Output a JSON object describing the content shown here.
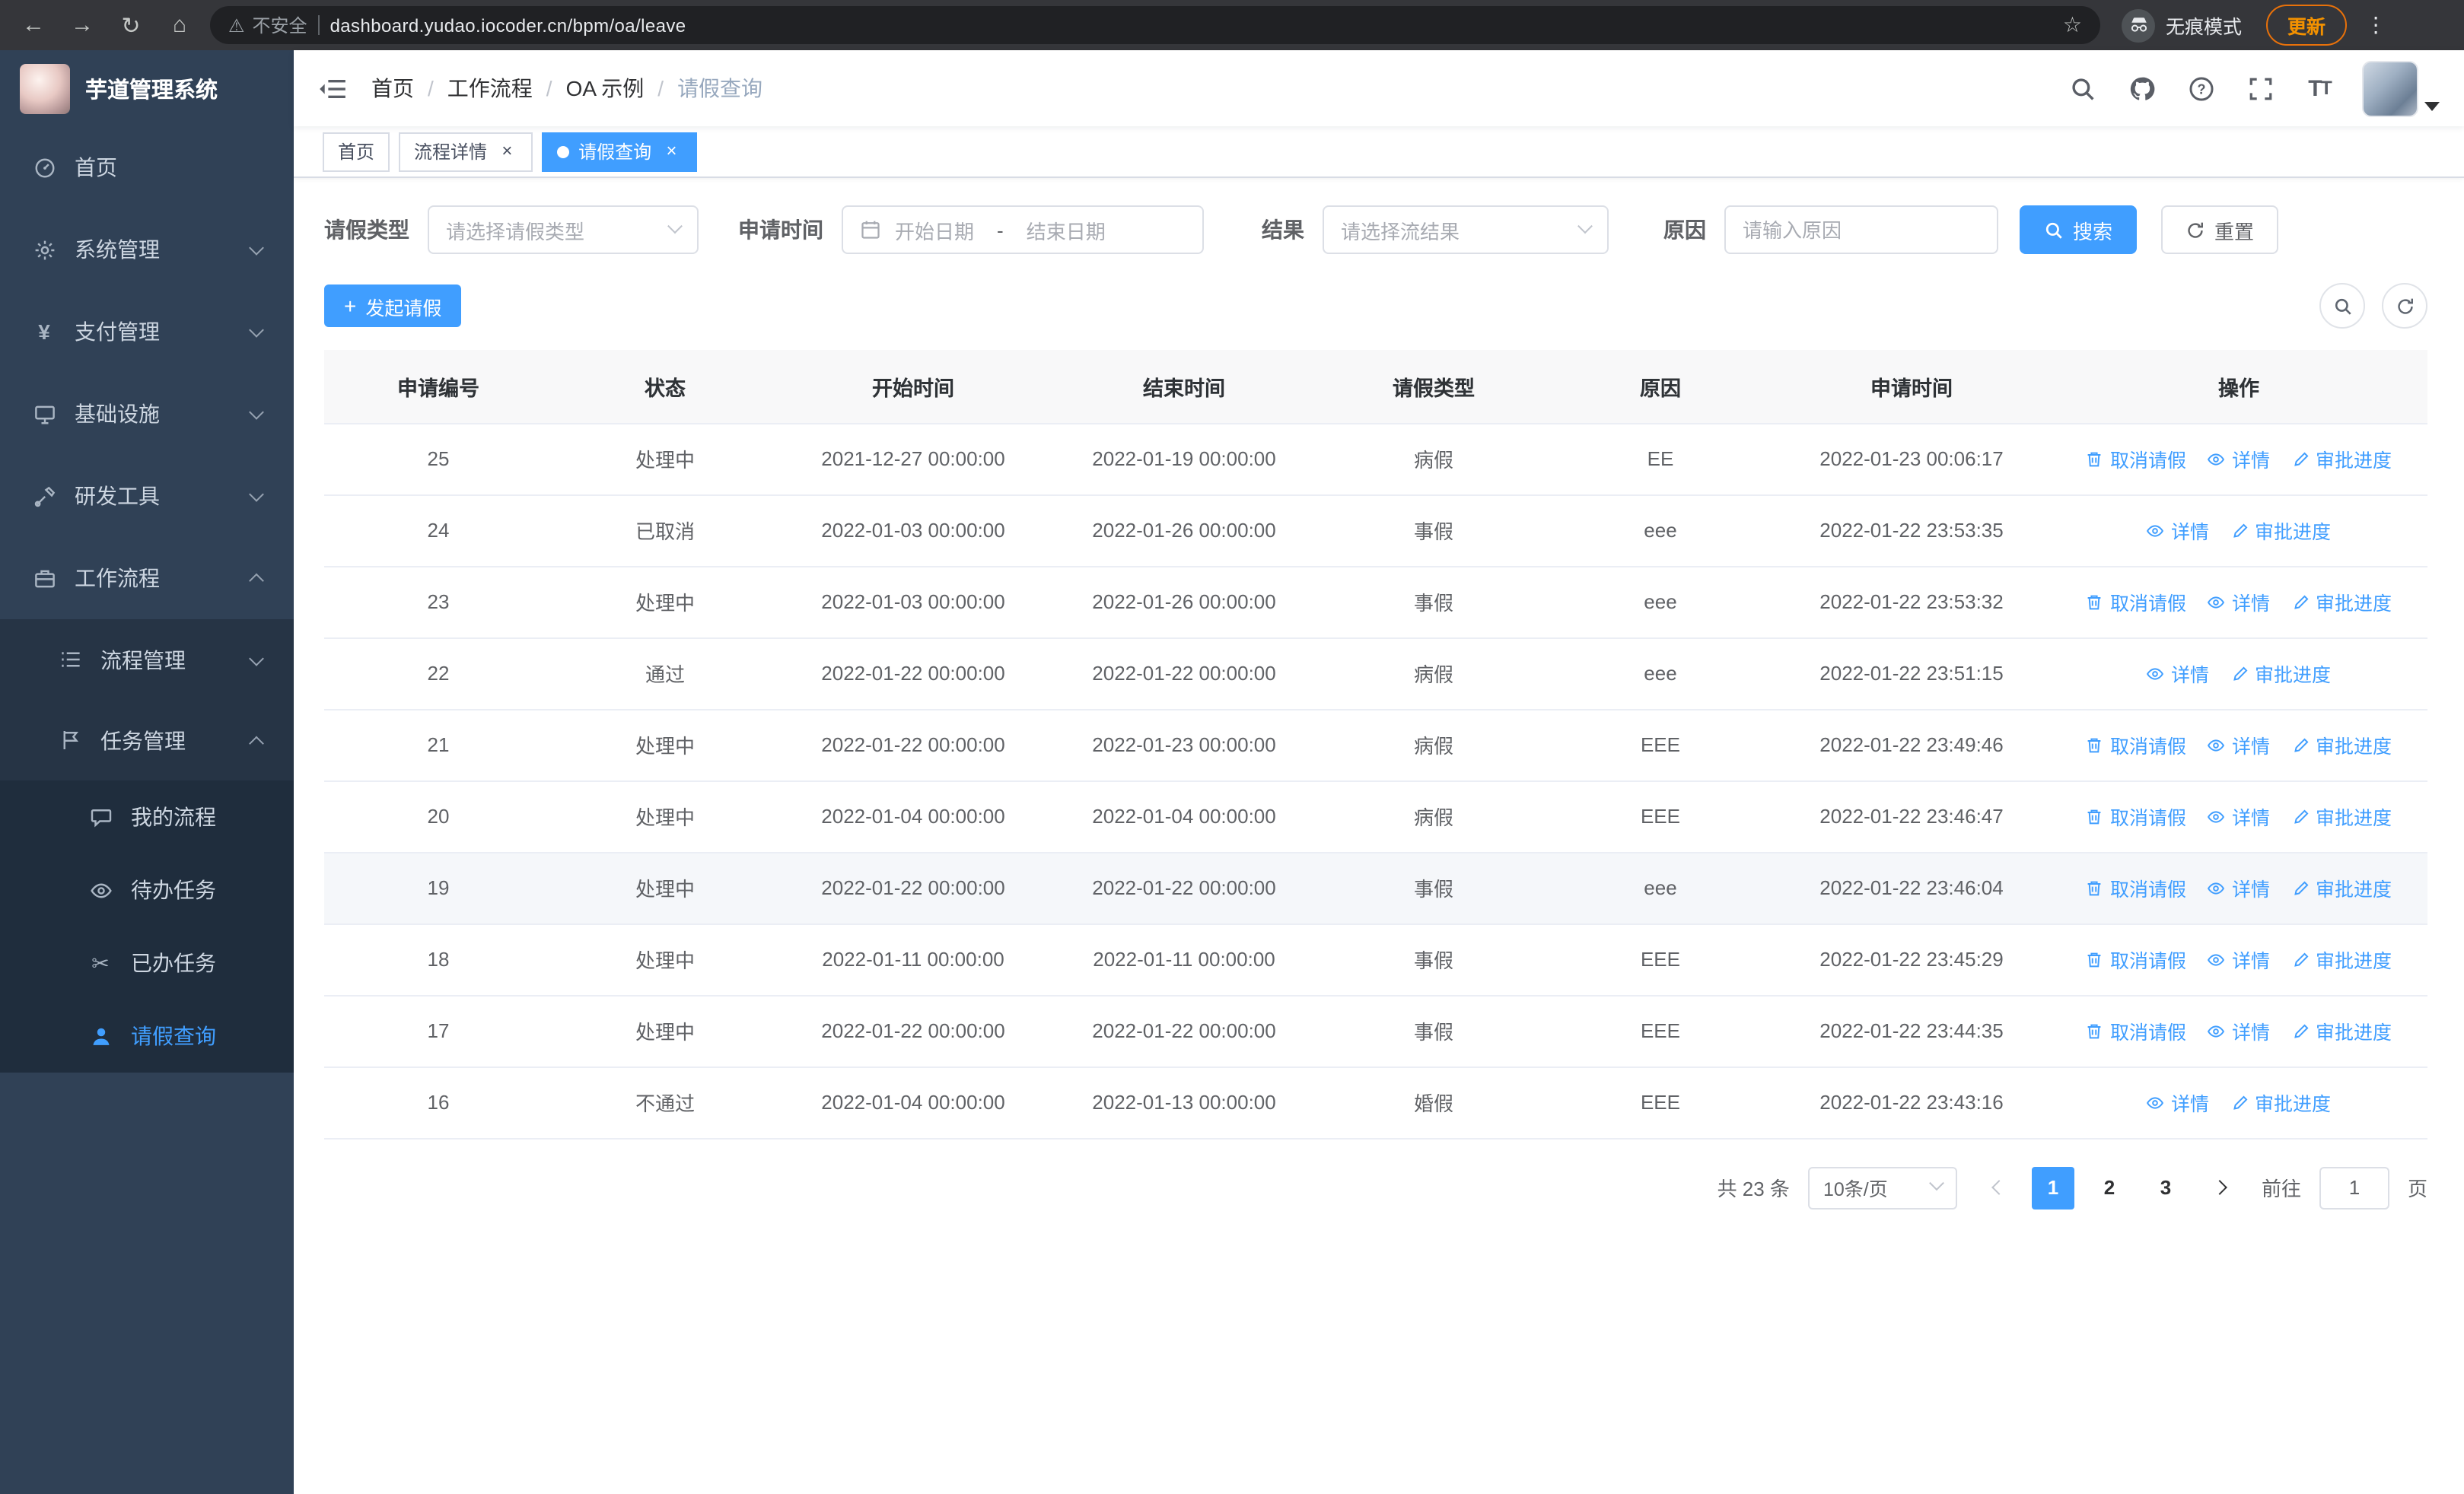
{
  "colors": {
    "accent": "#409eff",
    "sidebar_bg": "#304156",
    "submenu_bg": "#1f2d3d",
    "update_orange": "#f29100",
    "chrome_bg": "#35363a"
  },
  "browser": {
    "security_warning": "不安全",
    "url": "dashboard.yudao.iocoder.cn/bpm/oa/leave",
    "incognito_label": "无痕模式",
    "update_button": "更新"
  },
  "sidebar": {
    "logo_title": "芋道管理系统",
    "items": [
      {
        "key": "home",
        "label": "首页",
        "icon": "dashboard-icon",
        "level": 1
      },
      {
        "key": "system",
        "label": "系统管理",
        "icon": "gear-icon",
        "level": 1,
        "expandable": true
      },
      {
        "key": "payment",
        "label": "支付管理",
        "icon": "yen-icon",
        "level": 1,
        "expandable": true
      },
      {
        "key": "infrastructure",
        "label": "基础设施",
        "icon": "infra-icon",
        "level": 1,
        "expandable": true
      },
      {
        "key": "devtools",
        "label": "研发工具",
        "icon": "tools-icon",
        "level": 1,
        "expandable": true
      },
      {
        "key": "workflow",
        "label": "工作流程",
        "icon": "workflow-icon",
        "level": 1,
        "expandable": true,
        "expanded": true
      },
      {
        "key": "process-mgmt",
        "label": "流程管理",
        "icon": "process-icon",
        "level": 2,
        "expandable": true
      },
      {
        "key": "task-mgmt",
        "label": "任务管理",
        "icon": "task-icon",
        "level": 2,
        "expandable": true,
        "expanded": true
      },
      {
        "key": "my-process",
        "label": "我的流程",
        "icon": "my-process-icon",
        "level": 3
      },
      {
        "key": "todo-tasks",
        "label": "待办任务",
        "icon": "todo-icon",
        "level": 3
      },
      {
        "key": "done-tasks",
        "label": "已办任务",
        "icon": "done-icon",
        "level": 3
      },
      {
        "key": "leave-query",
        "label": "请假查询",
        "icon": "leave-icon",
        "level": 3,
        "active": true
      }
    ]
  },
  "header": {
    "breadcrumb": [
      "首页",
      "工作流程",
      "OA 示例",
      "请假查询"
    ],
    "breadcrumb_separator": "/"
  },
  "tabs": [
    {
      "label": "首页",
      "closable": false,
      "active": false
    },
    {
      "label": "流程详情",
      "closable": true,
      "active": false
    },
    {
      "label": "请假查询",
      "closable": true,
      "active": true
    }
  ],
  "filters": {
    "leave_type_label": "请假类型",
    "leave_type_placeholder": "请选择请假类型",
    "apply_time_label": "申请时间",
    "start_date_placeholder": "开始日期",
    "range_separator": "-",
    "end_date_placeholder": "结束日期",
    "result_label": "结果",
    "result_placeholder": "请选择流结果",
    "reason_label": "原因",
    "reason_placeholder": "请输入原因",
    "search_button": "搜索",
    "reset_button": "重置"
  },
  "toolbar": {
    "create_button": "发起请假"
  },
  "table": {
    "columns": [
      "申请编号",
      "状态",
      "开始时间",
      "结束时间",
      "请假类型",
      "原因",
      "申请时间",
      "操作"
    ],
    "action_labels": {
      "cancel": "取消请假",
      "detail": "详情",
      "progress": "审批进度"
    },
    "rows": [
      {
        "id": "25",
        "status": "处理中",
        "start": "2021-12-27 00:00:00",
        "end": "2022-01-19 00:00:00",
        "type": "病假",
        "reason": "EE",
        "applied": "2022-01-23 00:06:17",
        "actions": [
          "cancel",
          "detail",
          "progress"
        ]
      },
      {
        "id": "24",
        "status": "已取消",
        "start": "2022-01-03 00:00:00",
        "end": "2022-01-26 00:00:00",
        "type": "事假",
        "reason": "eee",
        "applied": "2022-01-22 23:53:35",
        "actions": [
          "detail",
          "progress"
        ]
      },
      {
        "id": "23",
        "status": "处理中",
        "start": "2022-01-03 00:00:00",
        "end": "2022-01-26 00:00:00",
        "type": "事假",
        "reason": "eee",
        "applied": "2022-01-22 23:53:32",
        "actions": [
          "cancel",
          "detail",
          "progress"
        ]
      },
      {
        "id": "22",
        "status": "通过",
        "start": "2022-01-22 00:00:00",
        "end": "2022-01-22 00:00:00",
        "type": "病假",
        "reason": "eee",
        "applied": "2022-01-22 23:51:15",
        "actions": [
          "detail",
          "progress"
        ]
      },
      {
        "id": "21",
        "status": "处理中",
        "start": "2022-01-22 00:00:00",
        "end": "2022-01-23 00:00:00",
        "type": "病假",
        "reason": "EEE",
        "applied": "2022-01-22 23:49:46",
        "actions": [
          "cancel",
          "detail",
          "progress"
        ]
      },
      {
        "id": "20",
        "status": "处理中",
        "start": "2022-01-04 00:00:00",
        "end": "2022-01-04 00:00:00",
        "type": "病假",
        "reason": "EEE",
        "applied": "2022-01-22 23:46:47",
        "actions": [
          "cancel",
          "detail",
          "progress"
        ]
      },
      {
        "id": "19",
        "status": "处理中",
        "start": "2022-01-22 00:00:00",
        "end": "2022-01-22 00:00:00",
        "type": "事假",
        "reason": "eee",
        "applied": "2022-01-22 23:46:04",
        "actions": [
          "cancel",
          "detail",
          "progress"
        ],
        "highlighted": true
      },
      {
        "id": "18",
        "status": "处理中",
        "start": "2022-01-11 00:00:00",
        "end": "2022-01-11 00:00:00",
        "type": "事假",
        "reason": "EEE",
        "applied": "2022-01-22 23:45:29",
        "actions": [
          "cancel",
          "detail",
          "progress"
        ]
      },
      {
        "id": "17",
        "status": "处理中",
        "start": "2022-01-22 00:00:00",
        "end": "2022-01-22 00:00:00",
        "type": "事假",
        "reason": "EEE",
        "applied": "2022-01-22 23:44:35",
        "actions": [
          "cancel",
          "detail",
          "progress"
        ]
      },
      {
        "id": "16",
        "status": "不通过",
        "start": "2022-01-04 00:00:00",
        "end": "2022-01-13 00:00:00",
        "type": "婚假",
        "reason": "EEE",
        "applied": "2022-01-22 23:43:16",
        "actions": [
          "detail",
          "progress"
        ]
      }
    ]
  },
  "pagination": {
    "total": "共 23 条",
    "page_size": "10条/页",
    "pages": [
      "1",
      "2",
      "3"
    ],
    "active_page": "1",
    "goto_label": "前往",
    "goto_value": "1",
    "page_label": "页"
  }
}
